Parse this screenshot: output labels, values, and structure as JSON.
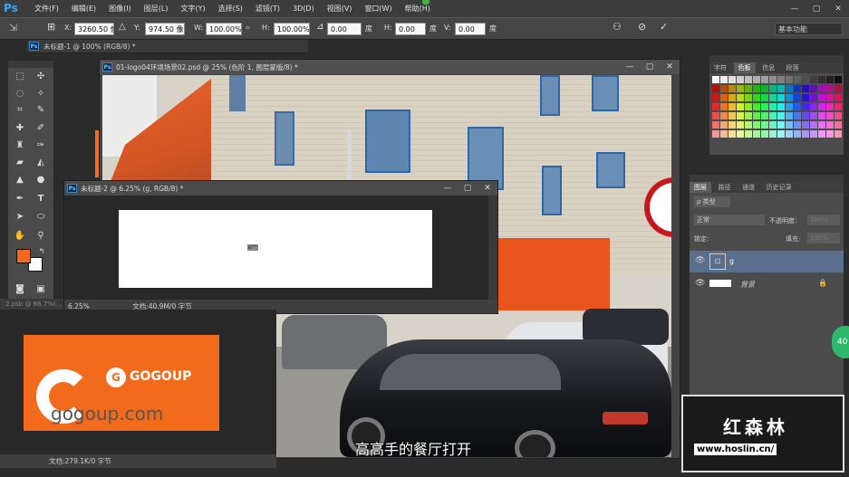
{
  "menubar": {
    "logo": "Ps",
    "items": [
      "文件(F)",
      "编辑(E)",
      "图像(I)",
      "图层(L)",
      "文字(Y)",
      "选择(S)",
      "滤镜(T)",
      "3D(D)",
      "视图(V)",
      "窗口(W)",
      "帮助(H)"
    ],
    "win_min": "—",
    "win_max": "▢",
    "win_close": "✕"
  },
  "options": {
    "x_label": "X:",
    "x_value": "3260.50 像",
    "y_label": "Y:",
    "y_value": "974.50 像",
    "w_label": "W:",
    "w_value": "100.00%",
    "h_label": "H:",
    "h_value": "100.00%",
    "angle_value": "0.00",
    "angle_unit": "度",
    "hskew_label": "H:",
    "hskew_value": "0.00",
    "hskew_unit": "度",
    "vskew_label": "V:",
    "vskew_value": "0.00",
    "vskew_unit": "度",
    "workspace": "基本功能"
  },
  "back_tab": {
    "title": "未标题-1 @ 100% (RGB/8) *"
  },
  "main_window": {
    "title": "01-logo04环境场景02.psd @ 25% (色阶 1, 图层蒙版/8) *"
  },
  "small_window": {
    "title": "未标题-2 @ 6.25% (g, RGB/8) *",
    "zoom": "6.25%",
    "doc": "文档:40.9M/0 字节",
    "mini_text": "eᴳᴼ"
  },
  "left_bottom": {
    "zoom": "2.psb @ 66.7%(...",
    "doc": "文档:279.1K/0 字节"
  },
  "logo_doc": {
    "brand": "GOGOUP",
    "url": "gogoup.com"
  },
  "swatches_panel": {
    "tabs": [
      "字符",
      "色板",
      "信息",
      "段落"
    ]
  },
  "layers_panel": {
    "tabs": [
      "图层",
      "路径",
      "通道",
      "历史记录"
    ],
    "kind": "ρ 类型",
    "blend": "正常",
    "opacity_label": "不透明度:",
    "opacity": "100%",
    "lock_label": "锁定:",
    "fill_label": "填充:",
    "fill": "100%",
    "layers": [
      {
        "name": "g"
      },
      {
        "name": "背景"
      }
    ]
  },
  "subtitle": "高高手的餐厅打开",
  "watermark": {
    "title": "红森林",
    "url": "www.hoslin.cn/"
  },
  "badge": "40",
  "colors": {
    "foreground": "#f26b1d",
    "background": "#ffffff",
    "accent": "#31a8ff"
  }
}
